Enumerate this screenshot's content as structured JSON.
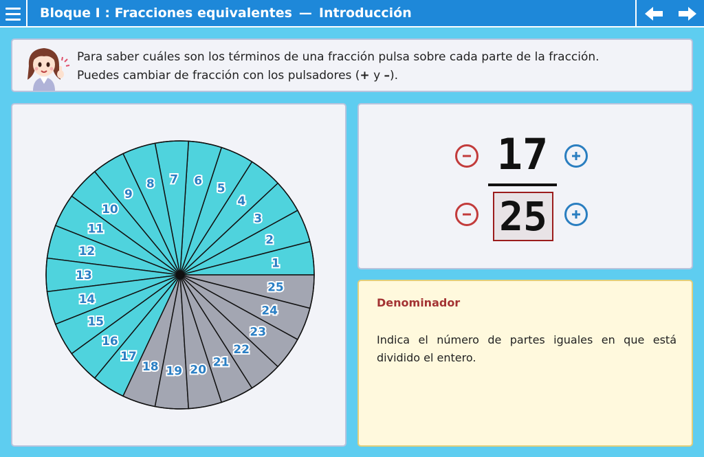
{
  "header": {
    "block": "Bloque I : Fracciones equivalentes",
    "separator": "—",
    "section": "Introducción",
    "menu_icon": "hamburger-menu-icon",
    "prev_icon": "arrow-left-icon",
    "next_icon": "arrow-right-icon"
  },
  "instructions": {
    "line1": "Para saber cuáles son los términos de una fracción pulsa sobre cada parte de la fracción.",
    "line2_prefix": "Puedes cambiar de fracción con los pulsadores (",
    "plus_sign": "+",
    "conj": " y ",
    "minus_sign": "–",
    "line2_suffix": ")."
  },
  "fraction": {
    "numerator": "17",
    "denominator": "25",
    "minus_icon": "minus-circle-icon",
    "plus_icon": "plus-circle-icon"
  },
  "pie": {
    "total_parts": 25,
    "filled_parts": 17,
    "filled_color": "#4fd3dd",
    "empty_color": "#a3a6b2",
    "label_color": "#2b7fc4"
  },
  "info": {
    "title": "Denominador",
    "body": "Indica el número de partes iguales en que está dividido el entero."
  },
  "colors": {
    "background": "#5ecdf0",
    "topbar": "#1e88d9",
    "minus": "#c23b3b",
    "plus": "#2a7ec0",
    "denominator_border": "#9b1c1c"
  }
}
